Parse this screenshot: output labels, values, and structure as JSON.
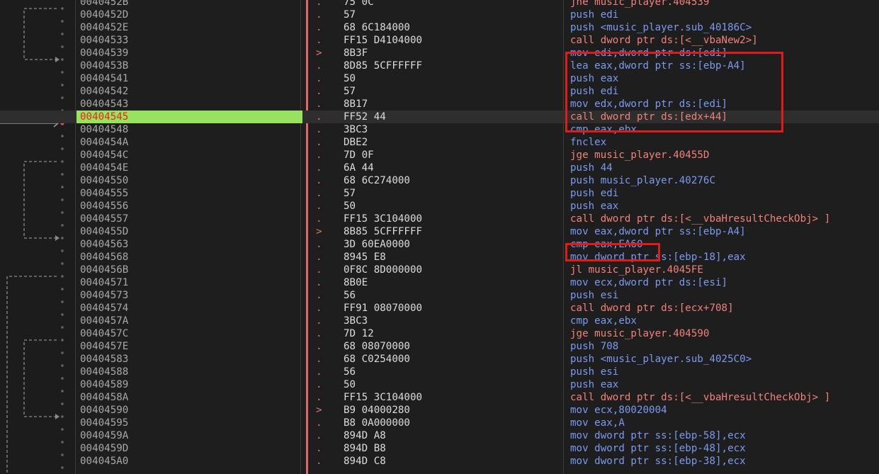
{
  "colors": {
    "accent_current": "#97e35f",
    "highlight_box": "#e21a1a"
  },
  "rows": [
    {
      "addr": "0040452B",
      "mark": ".",
      "bytes": "75 0C",
      "asm": "jne music_player.404539",
      "kind": "jmp"
    },
    {
      "addr": "0040452D",
      "mark": ".",
      "bytes": "57",
      "asm": "push edi",
      "kind": "push"
    },
    {
      "addr": "0040452E",
      "mark": ".",
      "bytes": "68 6C184000",
      "asm": "push <music_player.sub_40186C>",
      "kind": "push"
    },
    {
      "addr": "00404533",
      "mark": ".",
      "bytes": "FF15 D4104000",
      "asm": "call dword ptr ds:[<__vbaNew2>]",
      "kind": "call"
    },
    {
      "addr": "00404539",
      "mark": ">",
      "bytes": "8B3F",
      "asm": "mov edi,dword ptr ds:[edi]",
      "kind": "mov"
    },
    {
      "addr": "0040453B",
      "mark": ".",
      "bytes": "8D85 5CFFFFFF",
      "asm": "lea eax,dword ptr ss:[ebp-A4]",
      "kind": "lea"
    },
    {
      "addr": "00404541",
      "mark": ".",
      "bytes": "50",
      "asm": "push eax",
      "kind": "push"
    },
    {
      "addr": "00404542",
      "mark": ".",
      "bytes": "57",
      "asm": "push edi",
      "kind": "push"
    },
    {
      "addr": "00404543",
      "mark": ".",
      "bytes": "8B17",
      "asm": "mov edx,dword ptr ds:[edi]",
      "kind": "mov"
    },
    {
      "addr": "00404545",
      "mark": ".",
      "bytes": "FF52 44",
      "asm": "call dword ptr ds:[edx+44]",
      "kind": "call",
      "current": true
    },
    {
      "addr": "00404548",
      "mark": ".",
      "bytes": "3BC3",
      "asm": "cmp eax,ebx",
      "kind": "cmp"
    },
    {
      "addr": "0040454A",
      "mark": ".",
      "bytes": "DBE2",
      "asm": "fnclex",
      "kind": "misc"
    },
    {
      "addr": "0040454C",
      "mark": ".",
      "bytes": "7D 0F",
      "asm": "jge music_player.40455D",
      "kind": "jmp"
    },
    {
      "addr": "0040454E",
      "mark": ".",
      "bytes": "6A 44",
      "asm": "push 44",
      "kind": "push"
    },
    {
      "addr": "00404550",
      "mark": ".",
      "bytes": "68 6C274000",
      "asm": "push music_player.40276C",
      "kind": "push"
    },
    {
      "addr": "00404555",
      "mark": ".",
      "bytes": "57",
      "asm": "push edi",
      "kind": "push"
    },
    {
      "addr": "00404556",
      "mark": ".",
      "bytes": "50",
      "asm": "push eax",
      "kind": "push"
    },
    {
      "addr": "00404557",
      "mark": ".",
      "bytes": "FF15 3C104000",
      "asm": "call dword ptr ds:[<__vbaHresultCheckObj> ]",
      "kind": "call"
    },
    {
      "addr": "0040455D",
      "mark": ">",
      "bytes": "8B85 5CFFFFFF",
      "asm": "mov eax,dword ptr ss:[ebp-A4]",
      "kind": "mov"
    },
    {
      "addr": "00404563",
      "mark": ".",
      "bytes": "3D 60EA0000",
      "asm": "cmp eax,EA60",
      "kind": "cmp"
    },
    {
      "addr": "00404568",
      "mark": ".",
      "bytes": "8945 E8",
      "asm": "mov dword ptr ss:[ebp-18],eax",
      "kind": "mov"
    },
    {
      "addr": "0040456B",
      "mark": ".",
      "bytes": "0F8C 8D000000",
      "asm": "jl music_player.4045FE",
      "kind": "jmp"
    },
    {
      "addr": "00404571",
      "mark": ".",
      "bytes": "8B0E",
      "asm": "mov ecx,dword ptr ds:[esi]",
      "kind": "mov"
    },
    {
      "addr": "00404573",
      "mark": ".",
      "bytes": "56",
      "asm": "push esi",
      "kind": "push"
    },
    {
      "addr": "00404574",
      "mark": ".",
      "bytes": "FF91 08070000",
      "asm": "call dword ptr ds:[ecx+708]",
      "kind": "call"
    },
    {
      "addr": "0040457A",
      "mark": ".",
      "bytes": "3BC3",
      "asm": "cmp eax,ebx",
      "kind": "cmp"
    },
    {
      "addr": "0040457C",
      "mark": ".",
      "bytes": "7D 12",
      "asm": "jge music_player.404590",
      "kind": "jmp"
    },
    {
      "addr": "0040457E",
      "mark": ".",
      "bytes": "68 08070000",
      "asm": "push 708",
      "kind": "push"
    },
    {
      "addr": "00404583",
      "mark": ".",
      "bytes": "68 C0254000",
      "asm": "push <music_player.sub_4025C0>",
      "kind": "push"
    },
    {
      "addr": "00404588",
      "mark": ".",
      "bytes": "56",
      "asm": "push esi",
      "kind": "push"
    },
    {
      "addr": "00404589",
      "mark": ".",
      "bytes": "50",
      "asm": "push eax",
      "kind": "push"
    },
    {
      "addr": "0040458A",
      "mark": ".",
      "bytes": "FF15 3C104000",
      "asm": "call dword ptr ds:[<__vbaHresultCheckObj> ]",
      "kind": "call"
    },
    {
      "addr": "00404590",
      "mark": ">",
      "bytes": "B9 04000280",
      "asm": "mov ecx,80020004",
      "kind": "mov"
    },
    {
      "addr": "00404595",
      "mark": ".",
      "bytes": "B8 0A000000",
      "asm": "mov eax,A",
      "kind": "mov"
    },
    {
      "addr": "0040459A",
      "mark": ".",
      "bytes": "894D A8",
      "asm": "mov dword ptr ss:[ebp-58],ecx",
      "kind": "mov"
    },
    {
      "addr": "0040459D",
      "mark": ".",
      "bytes": "894D B8",
      "asm": "mov dword ptr ss:[ebp-48],ecx",
      "kind": "mov"
    },
    {
      "addr": "004045A0",
      "mark": ".",
      "bytes": "894D C8",
      "asm": "mov dword ptr ss:[ebp-38],ecx",
      "kind": "mov"
    }
  ]
}
